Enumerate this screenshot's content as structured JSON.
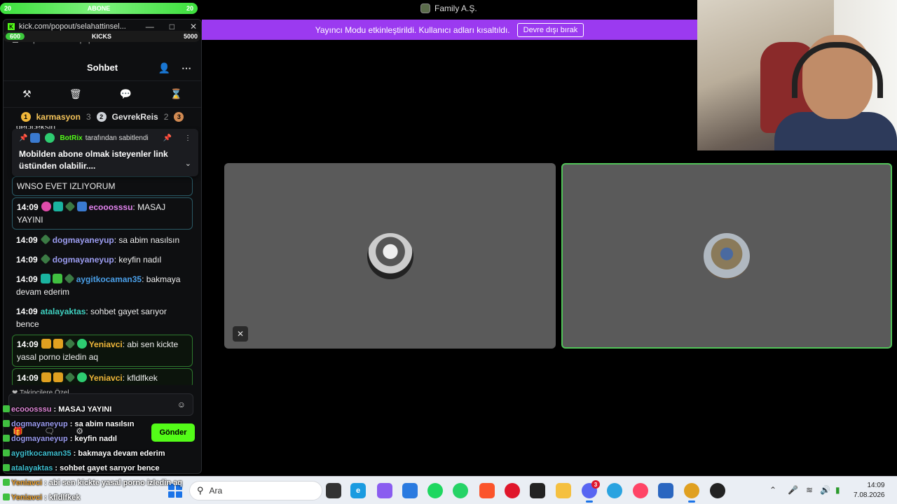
{
  "overlay_top": {
    "sub_label": "ABONE",
    "sub_left": "20",
    "sub_right": "20",
    "kicks_label": "KICKS",
    "kicks_left": "600",
    "kicks_right": "5000"
  },
  "popout": {
    "tab_title": "kick.com/popout/selahattinsel...",
    "url": "https://kick.com/popout/selahattinselcuk/c...",
    "header_title": "Sohbet",
    "leaderboard": [
      {
        "rank": "1",
        "name": "karmasyon",
        "count": "3",
        "tier": "gold"
      },
      {
        "rank": "2",
        "name": "GevrekReis",
        "count": "2",
        "tier": "silver"
      },
      {
        "rank": "3",
        "name": "",
        "count": "",
        "tier": "bronze"
      }
    ],
    "pinned": {
      "by_user": "BotRix",
      "by_suffix": "tarafından sabitlendi",
      "text": "Mobilden abone olmak isteyenler link üstünden olabilir...."
    },
    "partial_line": "geciceksin",
    "messages": [
      {
        "time": "",
        "user": "",
        "text": "WNSO EVET IZLIYORUM",
        "color": "#eee",
        "style": "hl-teal"
      },
      {
        "time": "14:09",
        "user": "ecooosssu",
        "text": "MASAJ YAYINI",
        "color": "#e283ee",
        "style": "hl-teal"
      },
      {
        "time": "14:09",
        "user": "dogmayaneyup",
        "text": "sa abim nasılsın",
        "color": "#9b9cf0",
        "style": ""
      },
      {
        "time": "14:09",
        "user": "dogmayaneyup",
        "text": "keyfin nadıl",
        "color": "#9b9cf0",
        "style": ""
      },
      {
        "time": "14:09",
        "user": "aygitkocaman35",
        "text": "bakmaya devam ederim",
        "color": "#4a9fe8",
        "style": ""
      },
      {
        "time": "14:09",
        "user": "atalayaktas",
        "text": "sohbet gayet sarıyor bence",
        "color": "#3fd0c0",
        "style": ""
      },
      {
        "time": "14:09",
        "user": "Yeniavci",
        "text": "abi sen kickte yasal porno izledin aq",
        "color": "#f0b73a",
        "style": "hl"
      },
      {
        "time": "14:09",
        "user": "Yeniavci",
        "text": "kfldlfkek",
        "color": "#f0b73a",
        "style": "hl"
      }
    ],
    "followers_only": "Takipçilere Özel",
    "send_label": "Gönder",
    "input_placeholder": ""
  },
  "stream_overlay_chat": [
    {
      "user": "ecooosssu",
      "text": ": MASAJ YAYINI",
      "color": "pink"
    },
    {
      "user": "dogmayaneyup",
      "text": ": sa abim nasılsın",
      "color": "purple"
    },
    {
      "user": "dogmayaneyup",
      "text": ": keyfin nadıl",
      "color": "purple"
    },
    {
      "user": "aygitkocaman35",
      "text": ": bakmaya devam ederim",
      "color": "teal"
    },
    {
      "user": "atalayaktas",
      "text": ": sohbet gayet sarıyor bence",
      "color": "teal"
    },
    {
      "user": "Yeniavci",
      "text": ": abi sen kickte yasal porno izledin aq",
      "color": "orange"
    },
    {
      "user": "Yeniavci",
      "text": ": kfldlfkek",
      "color": "orange"
    }
  ],
  "discord": {
    "server_title": "Family A.Ş.",
    "banner_text": "Yayıncı Modu etkinleştirildi. Kullanıcı adları kısaltıldı.",
    "banner_button": "Devre dışı bırak"
  },
  "taskbar": {
    "search_placeholder": "Ara",
    "time": "14:09",
    "date": "7.08.2026",
    "discord_badge": "3"
  }
}
